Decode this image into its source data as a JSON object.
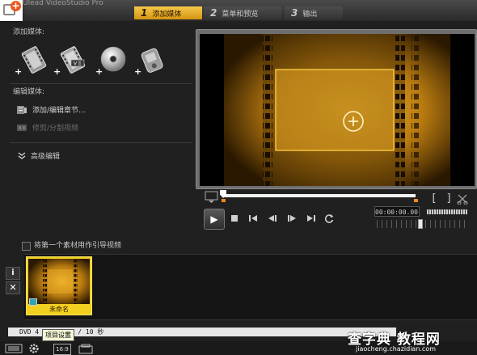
{
  "window": {
    "title": "Ulead VideoStudio Pro"
  },
  "steps": [
    {
      "num": "1",
      "label": "添加媒体",
      "active": true
    },
    {
      "num": "2",
      "label": "菜单和预览",
      "active": false
    },
    {
      "num": "3",
      "label": "输出",
      "active": false
    }
  ],
  "left_panel": {
    "add_media_label": "添加媒体:",
    "media_buttons": [
      {
        "name": "add-video",
        "icon": "film-icon"
      },
      {
        "name": "add-vsp-project",
        "icon": "vsp-file-icon"
      },
      {
        "name": "add-disc",
        "icon": "disc-icon"
      },
      {
        "name": "add-device",
        "icon": "camcorder-icon"
      }
    ],
    "edit_media_label": "编辑媒体:",
    "add_edit_chapters": "添加/编辑章节...",
    "multi_trim_video": "修剪/分割视频",
    "advanced_edit": "高级编辑"
  },
  "preview": {
    "timecode": "00:00:00.00",
    "zoom_level": 0.45
  },
  "checkbox_first_clip_intro": {
    "label": "将第一个素材用作引导视频",
    "checked": false
  },
  "storyboard": {
    "clips": [
      {
        "name": "未命名"
      }
    ]
  },
  "status": {
    "text": "DVD 4    11.13 MB / 10 秒"
  },
  "tooltip": {
    "text": "项目设置"
  },
  "bottom": {
    "aspect_label": "16:9"
  },
  "watermark": {
    "title": "查字典 教程网",
    "url": "jiaocheng.chazidian.com"
  },
  "colors": {
    "accent": "#f0b030",
    "highlight": "#f2d020",
    "background": "#202020"
  }
}
